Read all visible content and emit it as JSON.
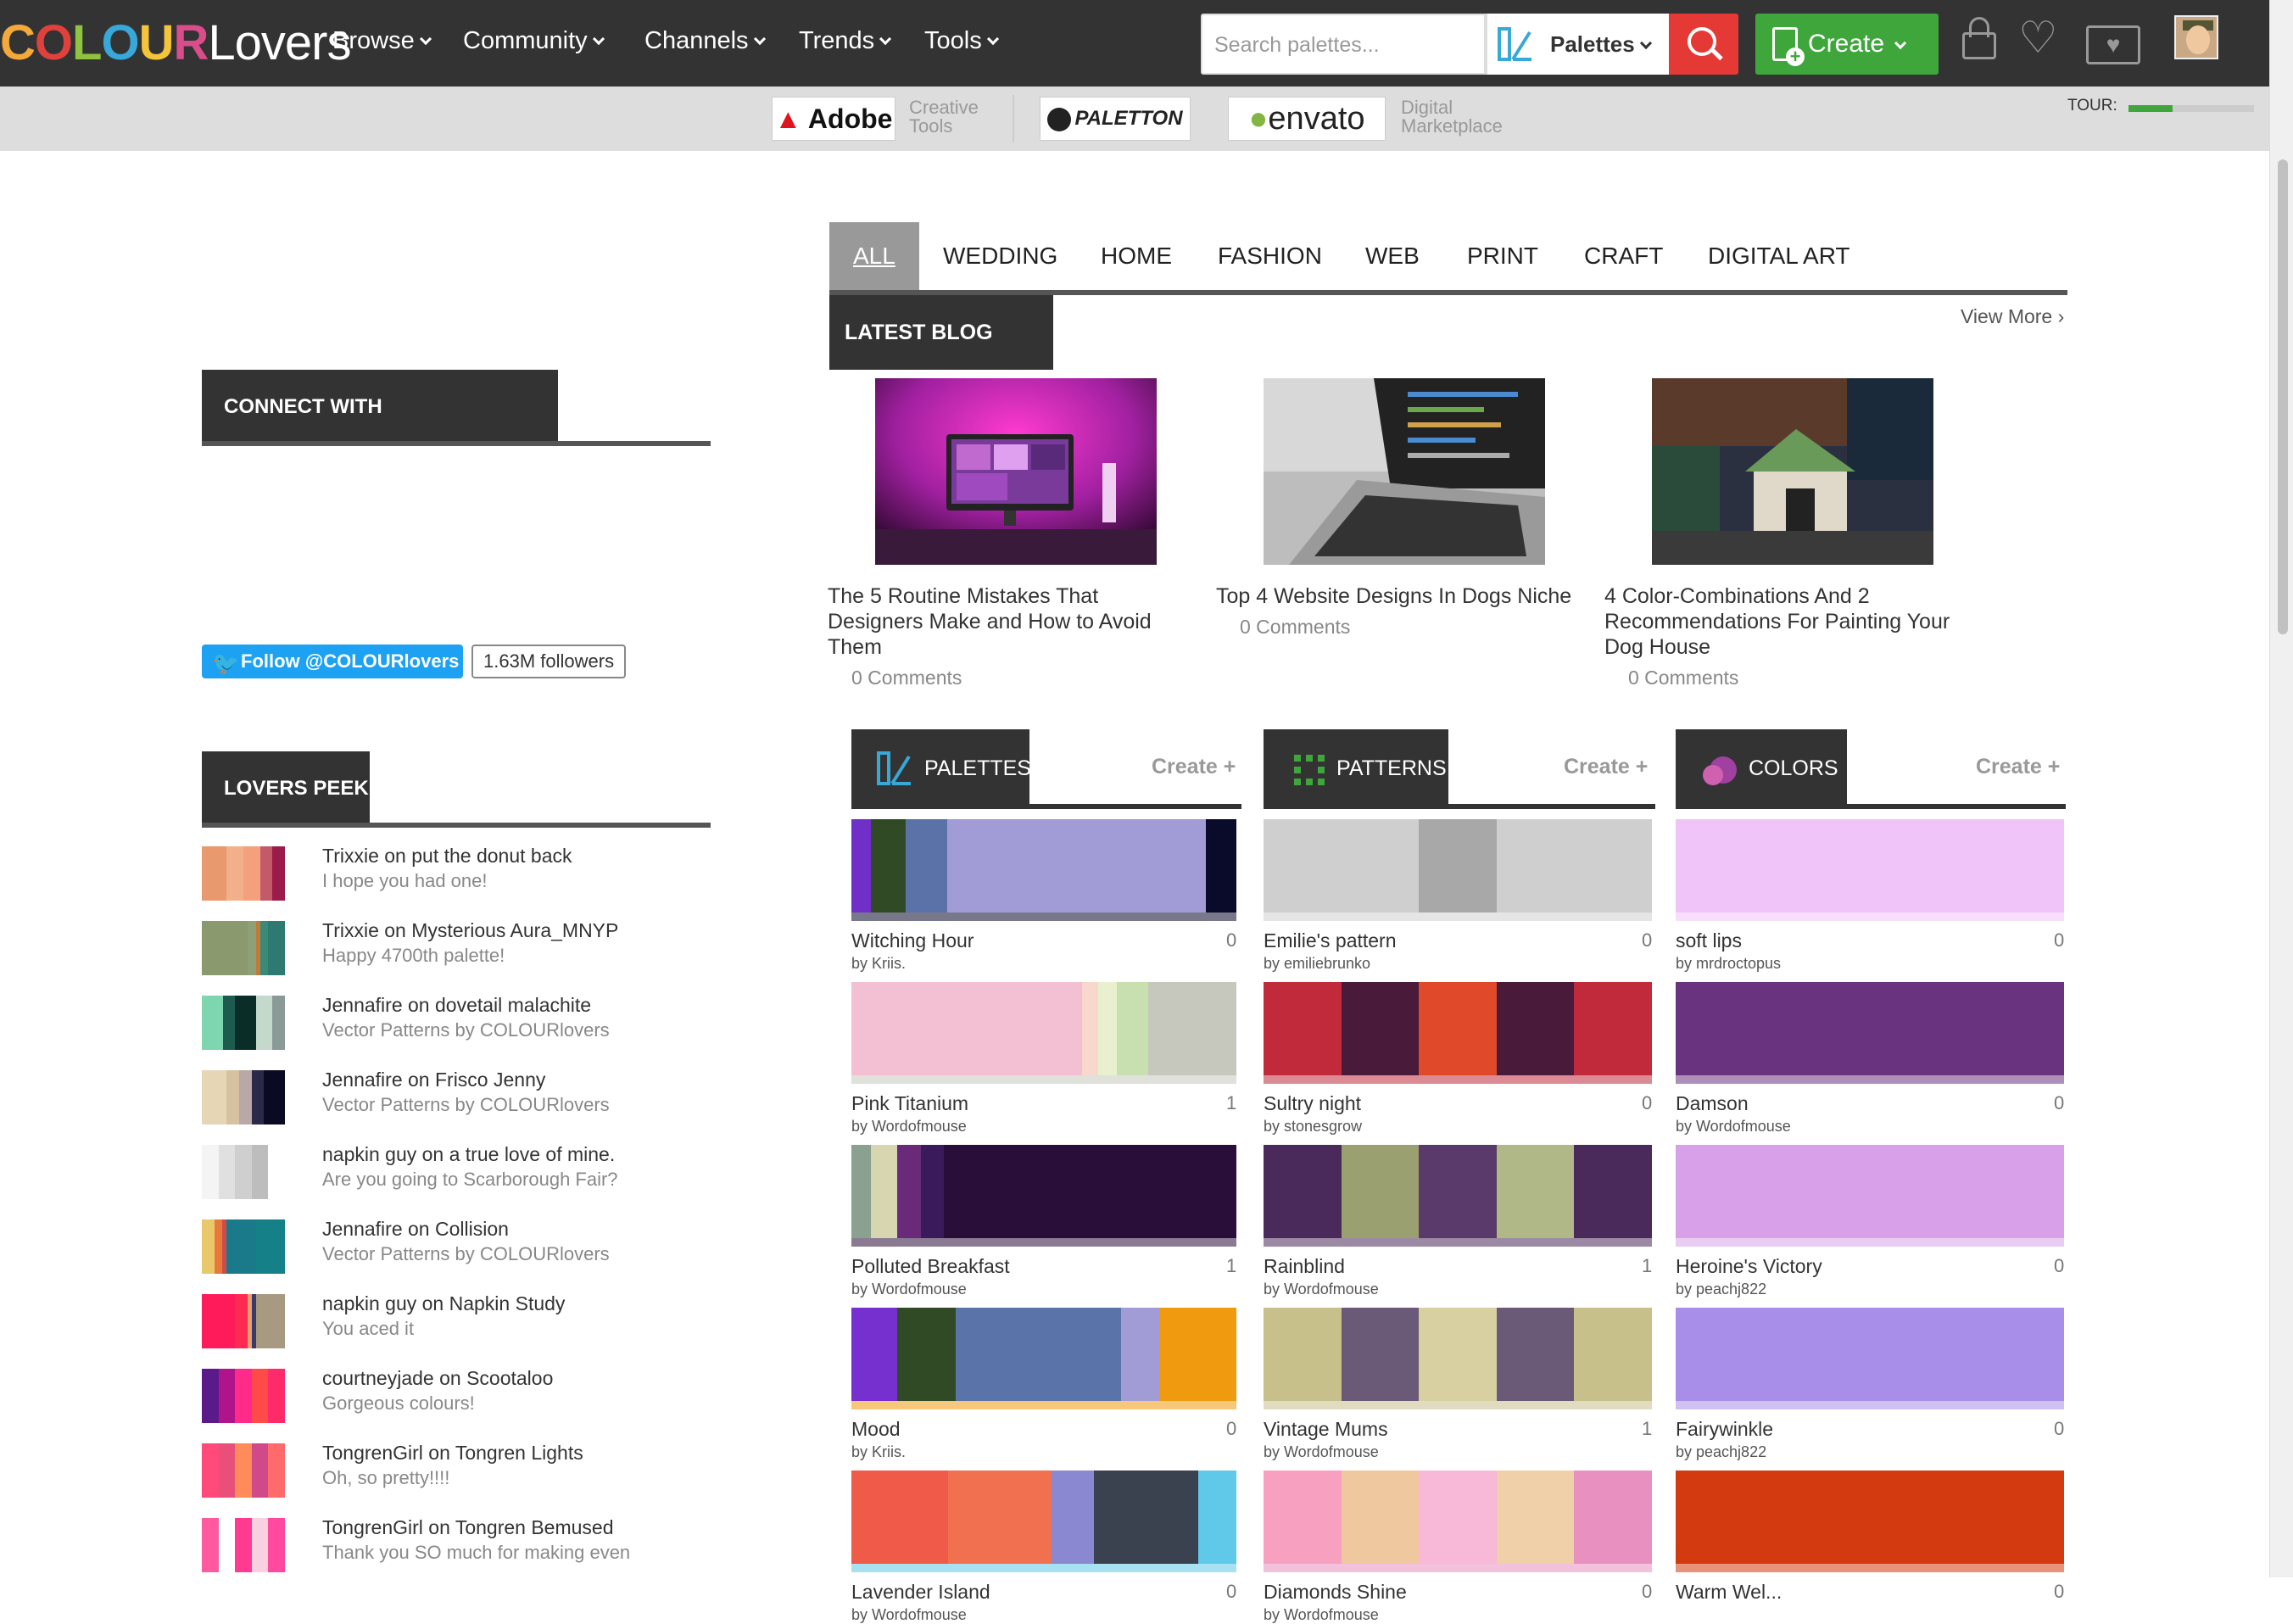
{
  "nav": {
    "logo_colour": "COLOUR",
    "logo_lovers": "Lovers",
    "menu": [
      "Browse",
      "Community",
      "Channels",
      "Trends",
      "Tools"
    ],
    "search_placeholder": "Search palettes...",
    "search_type": "Palettes",
    "create_label": "Create"
  },
  "sponsors": {
    "adobe": "Adobe",
    "adobe_sub1": "Creative",
    "adobe_sub2": "Tools",
    "paletton": "PALETTON",
    "envato": "envato",
    "envato_sub1": "Digital",
    "envato_sub2": "Marketplace",
    "tour_label": "TOUR:",
    "tour_progress": 0.35
  },
  "tabs": [
    "ALL",
    "WEDDING",
    "HOME",
    "FASHION",
    "WEB",
    "PRINT",
    "CRAFT",
    "DIGITAL ART"
  ],
  "blog": {
    "heading": "LATEST BLOG POSTS",
    "view_more": "View More ›",
    "posts": [
      {
        "title_lines": [
          "The 5 Routine Mistakes That",
          "Designers Make and How to Avoid",
          "Them"
        ],
        "comments": "0 Comments"
      },
      {
        "title_lines": [
          "Top 4 Website Designs In Dogs Niche"
        ],
        "comments": "0 Comments"
      },
      {
        "title_lines": [
          "4 Color-Combinations And 2",
          "Recommendations For Painting Your",
          "Dog House"
        ],
        "comments": "0 Comments"
      }
    ]
  },
  "connect": {
    "heading": "CONNECT WITH COLOURLOVERS",
    "follow_label": "Follow @COLOURlovers",
    "followers": "1.63M followers"
  },
  "peek": {
    "heading": "LOVERS PEEK",
    "items": [
      {
        "title": "Trixxie on put the donut back",
        "sub": "I hope you had one!",
        "colors": [
          "#e89a6e",
          "#f2b08a",
          "#f4a07c",
          "#c25a6a",
          "#9b1b4a"
        ],
        "widths": [
          30,
          20,
          20,
          15,
          15
        ]
      },
      {
        "title": "Trixxie on Mysterious Aura_MNYP",
        "sub": "Happy 4700th palette!",
        "colors": [
          "#8a9a6e",
          "#8fa078",
          "#c07a3a",
          "#3a8a7a",
          "#2f7a70"
        ],
        "widths": [
          55,
          10,
          5,
          10,
          20
        ]
      },
      {
        "title": "Jennafire on dovetail malachite",
        "sub": "Vector Patterns by COLOURlovers",
        "colors": [
          "#7ed6b0",
          "#1c5b4e",
          "#0a2d28",
          "#c4d8cc",
          "#8a9a96"
        ],
        "widths": [
          25,
          15,
          25,
          20,
          15
        ]
      },
      {
        "title": "Jennafire on Frisco Jenny",
        "sub": "Vector Patterns by COLOURlovers",
        "colors": [
          "#e6d6b6",
          "#d6c2a0",
          "#b8a8a8",
          "#2a2a48",
          "#0a0a22"
        ],
        "widths": [
          30,
          15,
          15,
          15,
          25
        ]
      },
      {
        "title": "napkin guy on a true love of mine.",
        "sub": "Are you going to Scarborough Fair?",
        "colors": [
          "#f4f4f4",
          "#e0e0e0",
          "#cfcfcf",
          "#bdbdbd",
          "#ffffff"
        ],
        "widths": [
          20,
          20,
          20,
          20,
          20
        ]
      },
      {
        "title": "Jennafire on Collision",
        "sub": "Vector Patterns by COLOURlovers",
        "colors": [
          "#e8c86a",
          "#e77a3a",
          "#d04a4a",
          "#1a7a8a",
          "#168088"
        ],
        "widths": [
          15,
          10,
          5,
          35,
          35
        ]
      },
      {
        "title": "napkin guy on Napkin Study",
        "sub": "You aced it",
        "colors": [
          "#ff1a5a",
          "#ff2a50",
          "#e8a070",
          "#3a3a6a",
          "#a89a80"
        ],
        "widths": [
          40,
          15,
          5,
          5,
          35
        ]
      },
      {
        "title": "courtneyjade on Scootaloo",
        "sub": "Gorgeous colours!",
        "colors": [
          "#5a1a8a",
          "#b0148a",
          "#ff2a8a",
          "#ff4a4a",
          "#ff2a6a"
        ],
        "widths": [
          20,
          20,
          20,
          20,
          20
        ]
      },
      {
        "title": "TongrenGirl on Tongren Lights",
        "sub": "Oh, so pretty!!!!",
        "colors": [
          "#ff4a7a",
          "#e8507a",
          "#ff8a5a",
          "#d04a8a",
          "#ff6a6a"
        ],
        "widths": [
          20,
          20,
          20,
          20,
          20
        ]
      },
      {
        "title": "TongrenGirl on Tongren Bemused",
        "sub": "Thank you SO much for making even",
        "colors": [
          "#ff5aa0",
          "#ffffff",
          "#ff3a90",
          "#f8d0e0",
          "#ff4aa0"
        ],
        "widths": [
          20,
          20,
          20,
          20,
          20
        ]
      }
    ]
  },
  "columns": {
    "palettes": {
      "heading": "PALETTES",
      "create": "Create +",
      "items": [
        {
          "name": "Witching Hour",
          "by": "by Kriis.",
          "count": "0",
          "colors": [
            "#7030c8",
            "#2f4a25",
            "#5a72a8",
            "#a29cd6",
            "#0a0a2a"
          ],
          "widths": [
            5,
            9,
            11,
            67,
            8
          ]
        },
        {
          "name": "Pink Titanium",
          "by": "by Wordofmouse",
          "count": "1",
          "colors": [
            "#f2c0d2",
            "#f8d8cc",
            "#e8f0d0",
            "#c8e0b0",
            "#c6c8be"
          ],
          "widths": [
            60,
            4,
            5,
            8,
            23
          ]
        },
        {
          "name": "Polluted Breakfast",
          "by": "by Wordofmouse",
          "count": "1",
          "colors": [
            "#8aa090",
            "#d8d6b0",
            "#6a2a7a",
            "#3a1a5a",
            "#2a0e3a"
          ],
          "widths": [
            5,
            7,
            6,
            6,
            76
          ]
        },
        {
          "name": "Mood",
          "by": "by Kriis.",
          "count": "0",
          "colors": [
            "#7630d0",
            "#2f4a25",
            "#5a74aa",
            "#a29cd6",
            "#f09a10"
          ],
          "widths": [
            12,
            15,
            43,
            10,
            20
          ]
        },
        {
          "name": "Lavender Island",
          "by": "by Wordofmouse",
          "count": "0",
          "colors": [
            "#f05a48",
            "#f07050",
            "#8a88d0",
            "#3a4250",
            "#60c8e8"
          ],
          "widths": [
            25,
            27,
            11,
            27,
            10
          ]
        }
      ]
    },
    "patterns": {
      "heading": "PATTERNS",
      "create": "Create +",
      "items": [
        {
          "name": "Emilie's pattern",
          "by": "by emiliebrunko",
          "count": "0",
          "colors": [
            "#cfcfcf",
            "#a8a8a8",
            "#cfcfcf"
          ],
          "widths": [
            40,
            20,
            40
          ]
        },
        {
          "name": "Sultry night",
          "by": "by stonesgrow",
          "count": "0",
          "colors": [
            "#c02a3a",
            "#4a1a3a",
            "#e04a2a",
            "#4a1a3a",
            "#c02a3a"
          ],
          "widths": [
            20,
            20,
            20,
            20,
            20
          ]
        },
        {
          "name": "Rainblind",
          "by": "by Wordofmouse",
          "count": "1",
          "colors": [
            "#4a2a5a",
            "#9aa070",
            "#5a3a6a",
            "#b0b888",
            "#4a2a5a"
          ],
          "widths": [
            20,
            20,
            20,
            20,
            20
          ]
        },
        {
          "name": "Vintage Mums",
          "by": "by Wordofmouse",
          "count": "1",
          "colors": [
            "#c8c08a",
            "#6a5a78",
            "#d8d0a0",
            "#6a5a78",
            "#c8c08a"
          ],
          "widths": [
            20,
            20,
            20,
            20,
            20
          ]
        },
        {
          "name": "Diamonds Shine",
          "by": "by Wordofmouse",
          "count": "0",
          "colors": [
            "#f8a0c0",
            "#f0c8a0",
            "#f8b8d8",
            "#f0d0a8",
            "#e890c0"
          ],
          "widths": [
            20,
            20,
            20,
            20,
            20
          ]
        }
      ]
    },
    "colors": {
      "heading": "COLORS",
      "create": "Create +",
      "items": [
        {
          "name": "soft lips",
          "by": "by mrdroctopus",
          "count": "0",
          "colors": [
            "#f0c4f8"
          ],
          "widths": [
            100
          ]
        },
        {
          "name": "Damson",
          "by": "by Wordofmouse",
          "count": "0",
          "colors": [
            "#6a3380"
          ],
          "widths": [
            100
          ]
        },
        {
          "name": "Heroine's Victory",
          "by": "by peachj822",
          "count": "0",
          "colors": [
            "#d8a0e8"
          ],
          "widths": [
            100
          ]
        },
        {
          "name": "Fairywinkle",
          "by": "by peachj822",
          "count": "0",
          "colors": [
            "#a88ee8"
          ],
          "widths": [
            100
          ]
        },
        {
          "name": "Warm Wel...",
          "by": "",
          "count": "0",
          "colors": [
            "#d43a10"
          ],
          "widths": [
            100
          ]
        }
      ]
    }
  }
}
